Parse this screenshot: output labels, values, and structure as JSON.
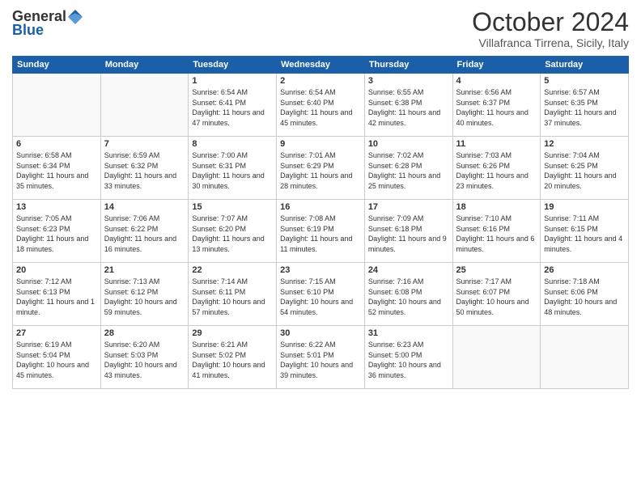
{
  "header": {
    "logo_general": "General",
    "logo_blue": "Blue",
    "month": "October 2024",
    "location": "Villafranca Tirrena, Sicily, Italy"
  },
  "weekdays": [
    "Sunday",
    "Monday",
    "Tuesday",
    "Wednesday",
    "Thursday",
    "Friday",
    "Saturday"
  ],
  "weeks": [
    [
      {
        "day": "",
        "sunrise": "",
        "sunset": "",
        "daylight": ""
      },
      {
        "day": "",
        "sunrise": "",
        "sunset": "",
        "daylight": ""
      },
      {
        "day": "1",
        "sunrise": "Sunrise: 6:54 AM",
        "sunset": "Sunset: 6:41 PM",
        "daylight": "Daylight: 11 hours and 47 minutes."
      },
      {
        "day": "2",
        "sunrise": "Sunrise: 6:54 AM",
        "sunset": "Sunset: 6:40 PM",
        "daylight": "Daylight: 11 hours and 45 minutes."
      },
      {
        "day": "3",
        "sunrise": "Sunrise: 6:55 AM",
        "sunset": "Sunset: 6:38 PM",
        "daylight": "Daylight: 11 hours and 42 minutes."
      },
      {
        "day": "4",
        "sunrise": "Sunrise: 6:56 AM",
        "sunset": "Sunset: 6:37 PM",
        "daylight": "Daylight: 11 hours and 40 minutes."
      },
      {
        "day": "5",
        "sunrise": "Sunrise: 6:57 AM",
        "sunset": "Sunset: 6:35 PM",
        "daylight": "Daylight: 11 hours and 37 minutes."
      }
    ],
    [
      {
        "day": "6",
        "sunrise": "Sunrise: 6:58 AM",
        "sunset": "Sunset: 6:34 PM",
        "daylight": "Daylight: 11 hours and 35 minutes."
      },
      {
        "day": "7",
        "sunrise": "Sunrise: 6:59 AM",
        "sunset": "Sunset: 6:32 PM",
        "daylight": "Daylight: 11 hours and 33 minutes."
      },
      {
        "day": "8",
        "sunrise": "Sunrise: 7:00 AM",
        "sunset": "Sunset: 6:31 PM",
        "daylight": "Daylight: 11 hours and 30 minutes."
      },
      {
        "day": "9",
        "sunrise": "Sunrise: 7:01 AM",
        "sunset": "Sunset: 6:29 PM",
        "daylight": "Daylight: 11 hours and 28 minutes."
      },
      {
        "day": "10",
        "sunrise": "Sunrise: 7:02 AM",
        "sunset": "Sunset: 6:28 PM",
        "daylight": "Daylight: 11 hours and 25 minutes."
      },
      {
        "day": "11",
        "sunrise": "Sunrise: 7:03 AM",
        "sunset": "Sunset: 6:26 PM",
        "daylight": "Daylight: 11 hours and 23 minutes."
      },
      {
        "day": "12",
        "sunrise": "Sunrise: 7:04 AM",
        "sunset": "Sunset: 6:25 PM",
        "daylight": "Daylight: 11 hours and 20 minutes."
      }
    ],
    [
      {
        "day": "13",
        "sunrise": "Sunrise: 7:05 AM",
        "sunset": "Sunset: 6:23 PM",
        "daylight": "Daylight: 11 hours and 18 minutes."
      },
      {
        "day": "14",
        "sunrise": "Sunrise: 7:06 AM",
        "sunset": "Sunset: 6:22 PM",
        "daylight": "Daylight: 11 hours and 16 minutes."
      },
      {
        "day": "15",
        "sunrise": "Sunrise: 7:07 AM",
        "sunset": "Sunset: 6:20 PM",
        "daylight": "Daylight: 11 hours and 13 minutes."
      },
      {
        "day": "16",
        "sunrise": "Sunrise: 7:08 AM",
        "sunset": "Sunset: 6:19 PM",
        "daylight": "Daylight: 11 hours and 11 minutes."
      },
      {
        "day": "17",
        "sunrise": "Sunrise: 7:09 AM",
        "sunset": "Sunset: 6:18 PM",
        "daylight": "Daylight: 11 hours and 9 minutes."
      },
      {
        "day": "18",
        "sunrise": "Sunrise: 7:10 AM",
        "sunset": "Sunset: 6:16 PM",
        "daylight": "Daylight: 11 hours and 6 minutes."
      },
      {
        "day": "19",
        "sunrise": "Sunrise: 7:11 AM",
        "sunset": "Sunset: 6:15 PM",
        "daylight": "Daylight: 11 hours and 4 minutes."
      }
    ],
    [
      {
        "day": "20",
        "sunrise": "Sunrise: 7:12 AM",
        "sunset": "Sunset: 6:13 PM",
        "daylight": "Daylight: 11 hours and 1 minute."
      },
      {
        "day": "21",
        "sunrise": "Sunrise: 7:13 AM",
        "sunset": "Sunset: 6:12 PM",
        "daylight": "Daylight: 10 hours and 59 minutes."
      },
      {
        "day": "22",
        "sunrise": "Sunrise: 7:14 AM",
        "sunset": "Sunset: 6:11 PM",
        "daylight": "Daylight: 10 hours and 57 minutes."
      },
      {
        "day": "23",
        "sunrise": "Sunrise: 7:15 AM",
        "sunset": "Sunset: 6:10 PM",
        "daylight": "Daylight: 10 hours and 54 minutes."
      },
      {
        "day": "24",
        "sunrise": "Sunrise: 7:16 AM",
        "sunset": "Sunset: 6:08 PM",
        "daylight": "Daylight: 10 hours and 52 minutes."
      },
      {
        "day": "25",
        "sunrise": "Sunrise: 7:17 AM",
        "sunset": "Sunset: 6:07 PM",
        "daylight": "Daylight: 10 hours and 50 minutes."
      },
      {
        "day": "26",
        "sunrise": "Sunrise: 7:18 AM",
        "sunset": "Sunset: 6:06 PM",
        "daylight": "Daylight: 10 hours and 48 minutes."
      }
    ],
    [
      {
        "day": "27",
        "sunrise": "Sunrise: 6:19 AM",
        "sunset": "Sunset: 5:04 PM",
        "daylight": "Daylight: 10 hours and 45 minutes."
      },
      {
        "day": "28",
        "sunrise": "Sunrise: 6:20 AM",
        "sunset": "Sunset: 5:03 PM",
        "daylight": "Daylight: 10 hours and 43 minutes."
      },
      {
        "day": "29",
        "sunrise": "Sunrise: 6:21 AM",
        "sunset": "Sunset: 5:02 PM",
        "daylight": "Daylight: 10 hours and 41 minutes."
      },
      {
        "day": "30",
        "sunrise": "Sunrise: 6:22 AM",
        "sunset": "Sunset: 5:01 PM",
        "daylight": "Daylight: 10 hours and 39 minutes."
      },
      {
        "day": "31",
        "sunrise": "Sunrise: 6:23 AM",
        "sunset": "Sunset: 5:00 PM",
        "daylight": "Daylight: 10 hours and 36 minutes."
      },
      {
        "day": "",
        "sunrise": "",
        "sunset": "",
        "daylight": ""
      },
      {
        "day": "",
        "sunrise": "",
        "sunset": "",
        "daylight": ""
      }
    ]
  ]
}
